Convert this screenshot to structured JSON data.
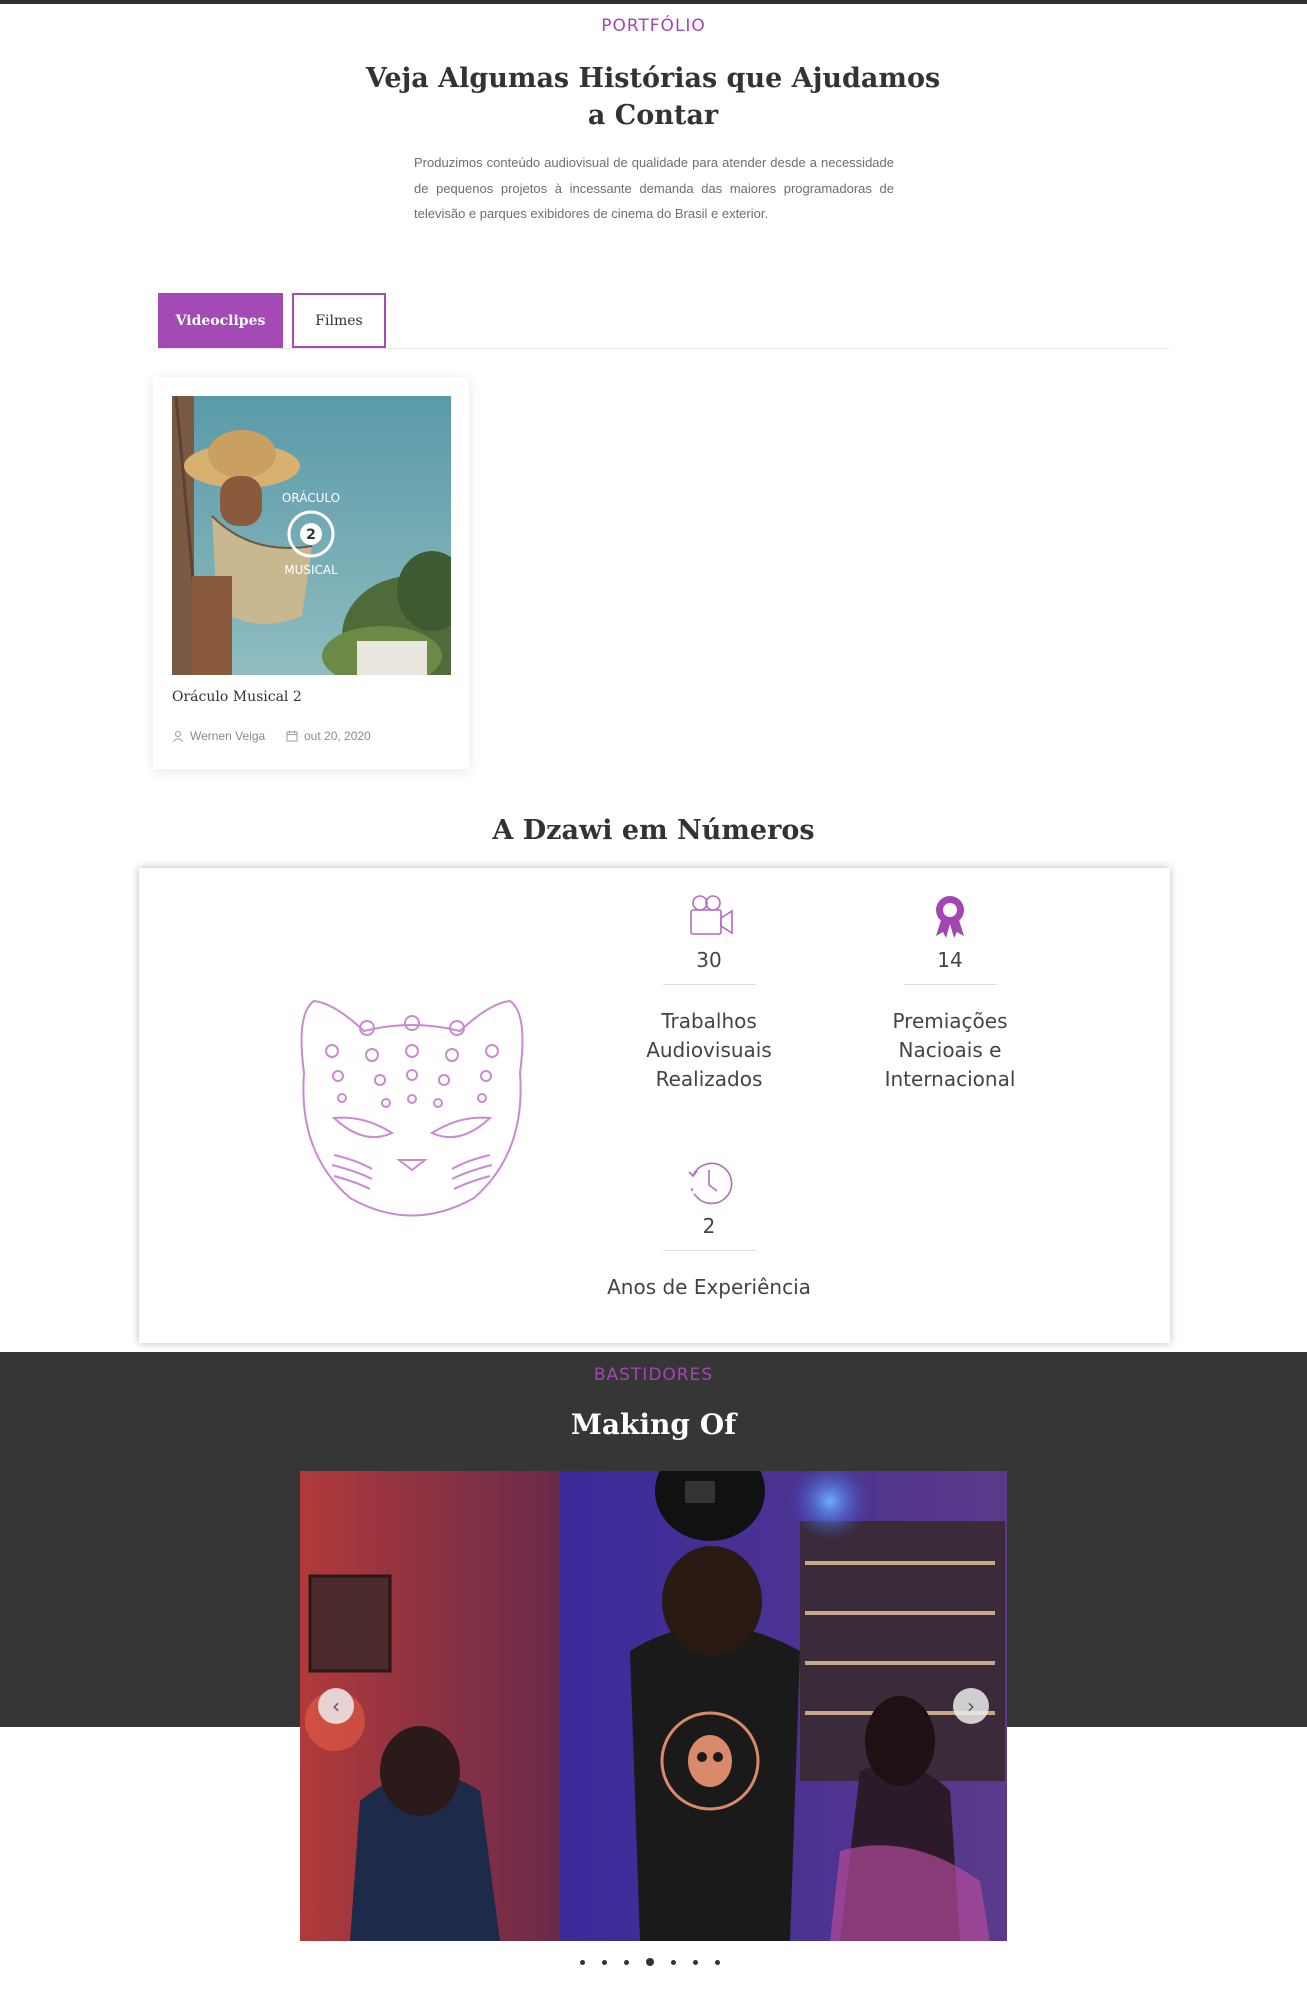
{
  "portfolio": {
    "eyebrow": "PORTFÓLIO",
    "title": "Veja Algumas Histórias que Ajudamos a Contar",
    "intro": "Produzimos conteúdo audiovisual de qualidade para atender desde a necessidade de pequenos projetos à incessante demanda das maiores programadoras de televisão e parques exibidores de cinema do Brasil e exterior.",
    "tabs": [
      {
        "label": "Videoclipes",
        "active": true
      },
      {
        "label": "Filmes",
        "active": false
      }
    ],
    "card": {
      "title": "Oráculo Musical 2",
      "author": "Wernen Veiga",
      "date": "out 20, 2020",
      "thumbnail_text_top": "ORÁCULO",
      "thumbnail_text_num": "2",
      "thumbnail_text_bottom": "MUSICAL"
    }
  },
  "numbers": {
    "title": "A Dzawi em Números",
    "stats": [
      {
        "icon": "camera-icon",
        "value": "30",
        "label_lines": [
          "Trabalhos",
          "Audiovisuais",
          "Realizados"
        ]
      },
      {
        "icon": "award-ribbon-icon",
        "value": "14",
        "label_lines": [
          "Premiações",
          "Nacioais e",
          "Internacional"
        ]
      },
      {
        "icon": "clock-history-icon",
        "value": "2",
        "label_lines": [
          "Anos de Experiência"
        ]
      }
    ]
  },
  "bastidores": {
    "eyebrow": "BASTIDORES",
    "title": "Making Of",
    "slide_count": 7,
    "active_slide": 4,
    "prev_arrow": "‹",
    "next_arrow": "›"
  },
  "colors": {
    "accent": "#a346b3",
    "dark_band": "#363636"
  }
}
